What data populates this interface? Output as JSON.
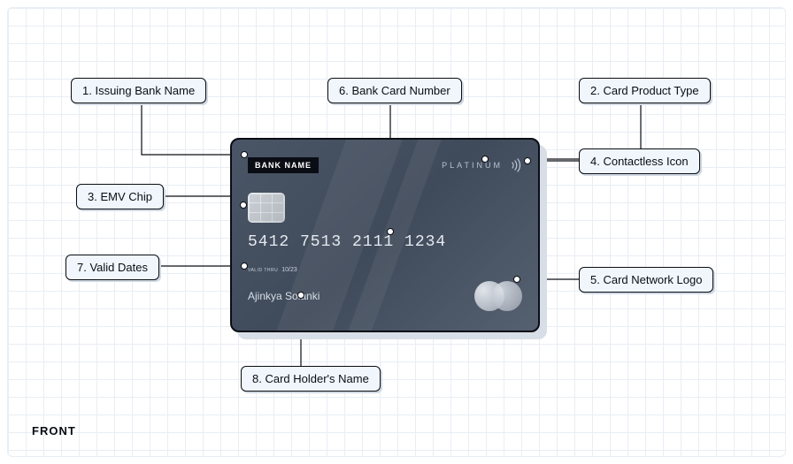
{
  "footer": "FRONT",
  "card": {
    "bank_name": "BANK NAME",
    "product_type": "PLATINUM",
    "number": "5412 7513 2111 1234",
    "valid_label": "VALID THRU",
    "valid_date": "10/23",
    "holder": "Ajinkya Solanki"
  },
  "callouts": {
    "c1": "1. Issuing Bank Name",
    "c2": "2. Card Product Type",
    "c3": "3. EMV Chip",
    "c4": "4. Contactless Icon",
    "c5": "5. Card Network Logo",
    "c6": "6.  Bank Card Number",
    "c7": "7. Valid Dates",
    "c8": "8. Card Holder's Name"
  }
}
